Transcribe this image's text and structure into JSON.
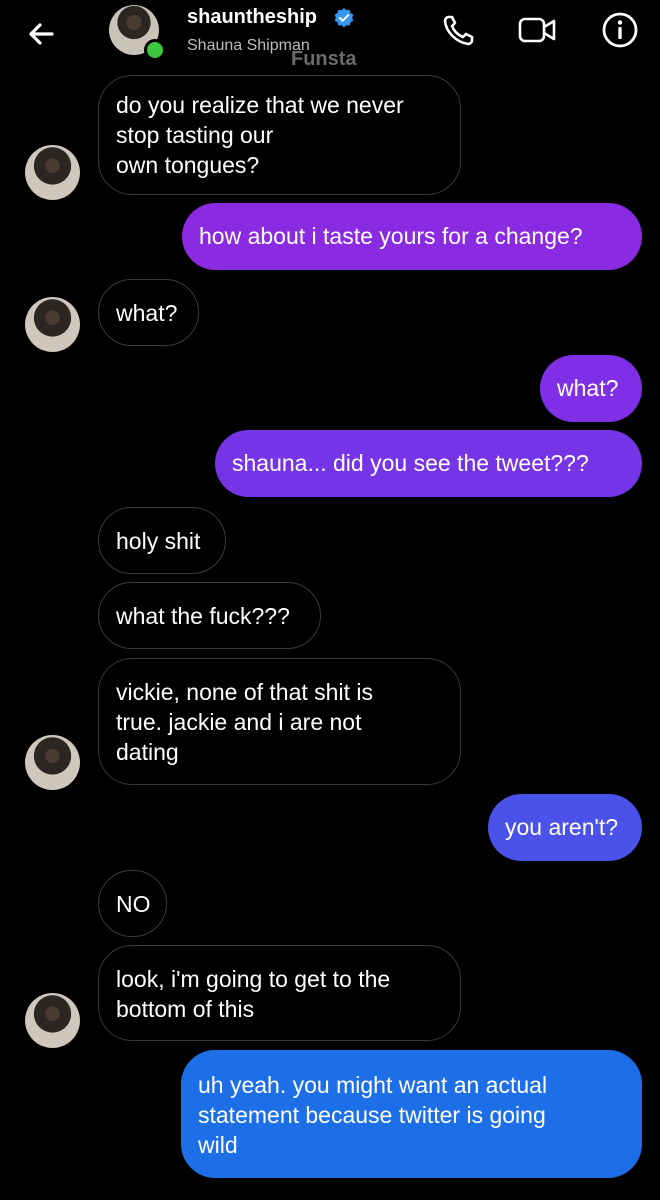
{
  "header": {
    "username": "shauntheship",
    "display_name": "Shauna Shipman",
    "watermark": "Funsta",
    "icons": [
      "back-arrow-icon",
      "verified-badge-icon",
      "phone-icon",
      "video-camera-icon",
      "info-icon"
    ]
  },
  "messages": [
    {
      "from": "them",
      "text": "do you realize that we never\nstop tasting our\nown tongues?"
    },
    {
      "from": "me",
      "text": "how about i taste yours for a change?"
    },
    {
      "from": "them",
      "text": "what?"
    },
    {
      "from": "me",
      "text": "what?"
    },
    {
      "from": "me",
      "text": "shauna... did you see the tweet???"
    },
    {
      "from": "them",
      "text": "holy shit"
    },
    {
      "from": "them",
      "text": "what the fuck???"
    },
    {
      "from": "them",
      "text": "vickie, none of that shit is\ntrue. jackie and i are not\ndating"
    },
    {
      "from": "me",
      "text": "you aren't?"
    },
    {
      "from": "them",
      "text": "NO"
    },
    {
      "from": "them",
      "text": "look, i'm going to get to the\nbottom of this"
    },
    {
      "from": "me",
      "text": "uh yeah. you might want an actual\nstatement because twitter is going\nwild"
    }
  ],
  "colors": {
    "outgoing_top": "#8a2be2",
    "outgoing_bottom": "#1d6fe8",
    "incoming_border": "#3a3a3a",
    "online": "#3cc83c"
  }
}
